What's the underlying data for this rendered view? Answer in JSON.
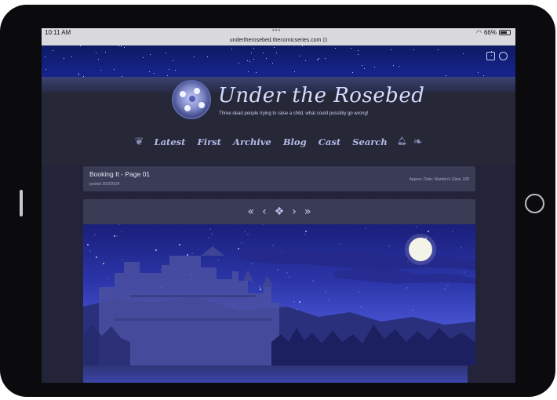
{
  "status_bar": {
    "time": "10:11 AM",
    "battery": "66%",
    "url": "undertherosebed.thecomicseries.com"
  },
  "site": {
    "title": "Under the Rosebed",
    "tagline": "Three dead people trying to raise a child, what could possibly go wrong!"
  },
  "nav": {
    "items": [
      "Latest",
      "First",
      "Archive",
      "Blog",
      "Cast",
      "Search"
    ]
  },
  "comic": {
    "page_title": "Booking It - Page 01",
    "posted": "posted 20/3/2024",
    "approx_date": "Approx. Date: Warden's Glow, 328"
  },
  "comic_nav": {
    "first": "«",
    "prev": "‹",
    "next": "›",
    "last": "»"
  },
  "icons": [
    "calendar-icon",
    "settings-icon",
    "bell-icon",
    "wifi-icon",
    "lock-icon"
  ],
  "colors": {
    "sky": "#15238a",
    "panel": "#3a3b55",
    "title_text": "#d6dbff",
    "nav_text": "#b5bbe8"
  }
}
